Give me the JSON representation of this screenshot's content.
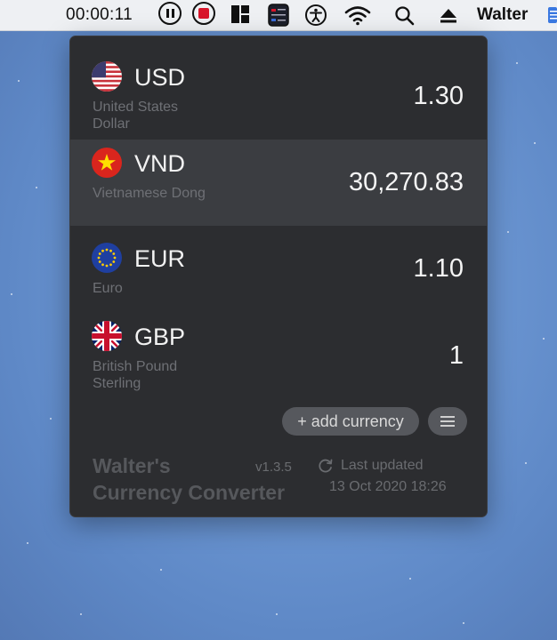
{
  "menubar": {
    "timer": "00:00:11",
    "user_name": "Walter"
  },
  "currencies": [
    {
      "code": "USD",
      "name": "United States Dollar",
      "amount": "1.30",
      "selected": false
    },
    {
      "code": "VND",
      "name": "Vietnamese Dong",
      "amount": "30,270.83",
      "selected": true
    },
    {
      "code": "EUR",
      "name": "Euro",
      "amount": "1.10",
      "selected": false
    },
    {
      "code": "GBP",
      "name": "British Pound Sterling",
      "amount": "1",
      "selected": false
    }
  ],
  "actions": {
    "add_currency_label": "+ add currency"
  },
  "footer": {
    "app_name_line1": "Walter's",
    "app_name_line2": "Currency Converter",
    "version": "v1.3.5",
    "last_updated_label": "Last updated",
    "last_updated_time": "13 Oct 2020 18:26"
  },
  "colors": {
    "popover_bg": "#2c2d30",
    "selected_row_bg": "#3b3d41",
    "record_red": "#d8152a"
  }
}
